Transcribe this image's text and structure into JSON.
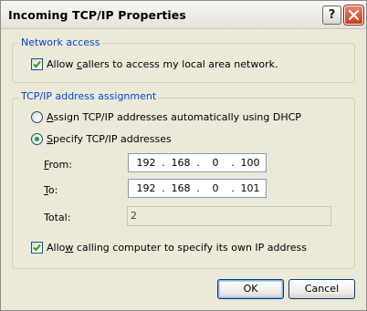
{
  "window": {
    "title": "Incoming TCP/IP Properties"
  },
  "title_buttons": {
    "help": "?",
    "close_icon": "close-icon"
  },
  "network_access": {
    "legend": "Network access",
    "allow_callers": {
      "pre": "Allow ",
      "hot": "c",
      "post": "allers to access my local area network.",
      "checked": true
    }
  },
  "tcpip": {
    "legend": "TCP/IP address assignment",
    "dhcp": {
      "hot": "A",
      "post": "ssign TCP/IP addresses automatically using DHCP",
      "selected": false
    },
    "specify": {
      "hot": "S",
      "post": "pecify TCP/IP addresses",
      "selected": true
    },
    "from": {
      "hot": "F",
      "post": "rom:",
      "octets": [
        "192",
        "168",
        "0",
        "100"
      ]
    },
    "to": {
      "hot": "T",
      "post": "o:",
      "octets": [
        "192",
        "168",
        "0",
        "101"
      ]
    },
    "total": {
      "label": "Total:",
      "value": "2"
    },
    "allow_specify": {
      "pre": "Allo",
      "hot": "w",
      "post": " calling computer to specify its own IP address",
      "checked": true
    }
  },
  "buttons": {
    "ok": "OK",
    "cancel": "Cancel"
  },
  "colors": {
    "dialog_bg": "#ece9d8",
    "legend_text": "#0046d5",
    "radio_dot": "#21a121",
    "close_button": "#c8391b"
  }
}
